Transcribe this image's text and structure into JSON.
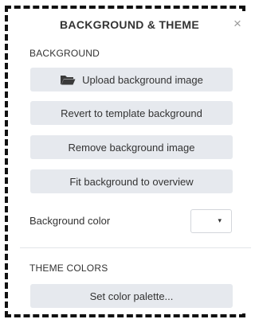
{
  "dialog": {
    "title": "BACKGROUND & THEME",
    "close_icon": "close-icon",
    "close_symbol": "×"
  },
  "background": {
    "heading": "BACKGROUND",
    "upload_label": "Upload background image",
    "upload_icon": "folder-open-icon",
    "revert_label": "Revert to template background",
    "remove_label": "Remove background image",
    "fit_label": "Fit background to overview",
    "color_label": "Background color",
    "color_value": "#ffffff",
    "caret_symbol": "▾"
  },
  "theme": {
    "heading": "THEME COLORS",
    "palette_label": "Set color palette..."
  },
  "colors": {
    "button_bg": "#e6e9ee",
    "text": "#333333",
    "close": "#9a9a9a",
    "frame": "#111111"
  }
}
